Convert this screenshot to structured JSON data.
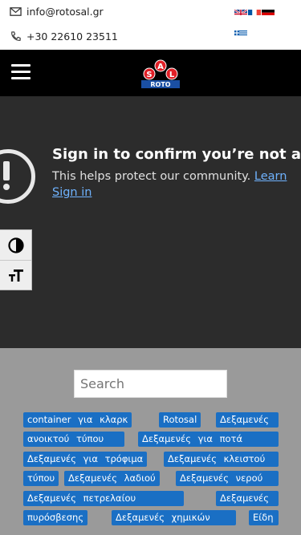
{
  "contact": {
    "email": "info@rotosal.gr",
    "phone": "+30 22610 23511"
  },
  "header": {
    "logo_letters": [
      "S",
      "A",
      "L"
    ],
    "logo_text": "ROTO"
  },
  "notice": {
    "title": "Sign in to confirm you’re not a bo",
    "body": "This helps protect our community.",
    "learn_link": "Learn",
    "signin_link": "Sign in"
  },
  "search": {
    "placeholder": "Search"
  },
  "tags": [
    "container για κλαρκ",
    "Rotosal",
    "Δεξαμενές",
    "ανοικτού τύπου",
    "Δεξαμενές για ποτά",
    "Δεξαμενές για τρόφιμα",
    "Δεξαμενές κλειστού",
    "τύπου",
    "Δεξαμενές λαδιού",
    "Δεξαμενές νερού",
    "Δεξαμενές πετρελαίου",
    "Δεξαμενές",
    "πυρόσβεσης",
    "Δεξαμενές χημικών",
    "Είδη"
  ],
  "colors": {
    "header_bg": "#000000",
    "main_bg": "#2c2c2c",
    "grey_bg": "#9a9a9a",
    "tag_bg": "#1a6fc4",
    "link": "#6fb3ff"
  }
}
